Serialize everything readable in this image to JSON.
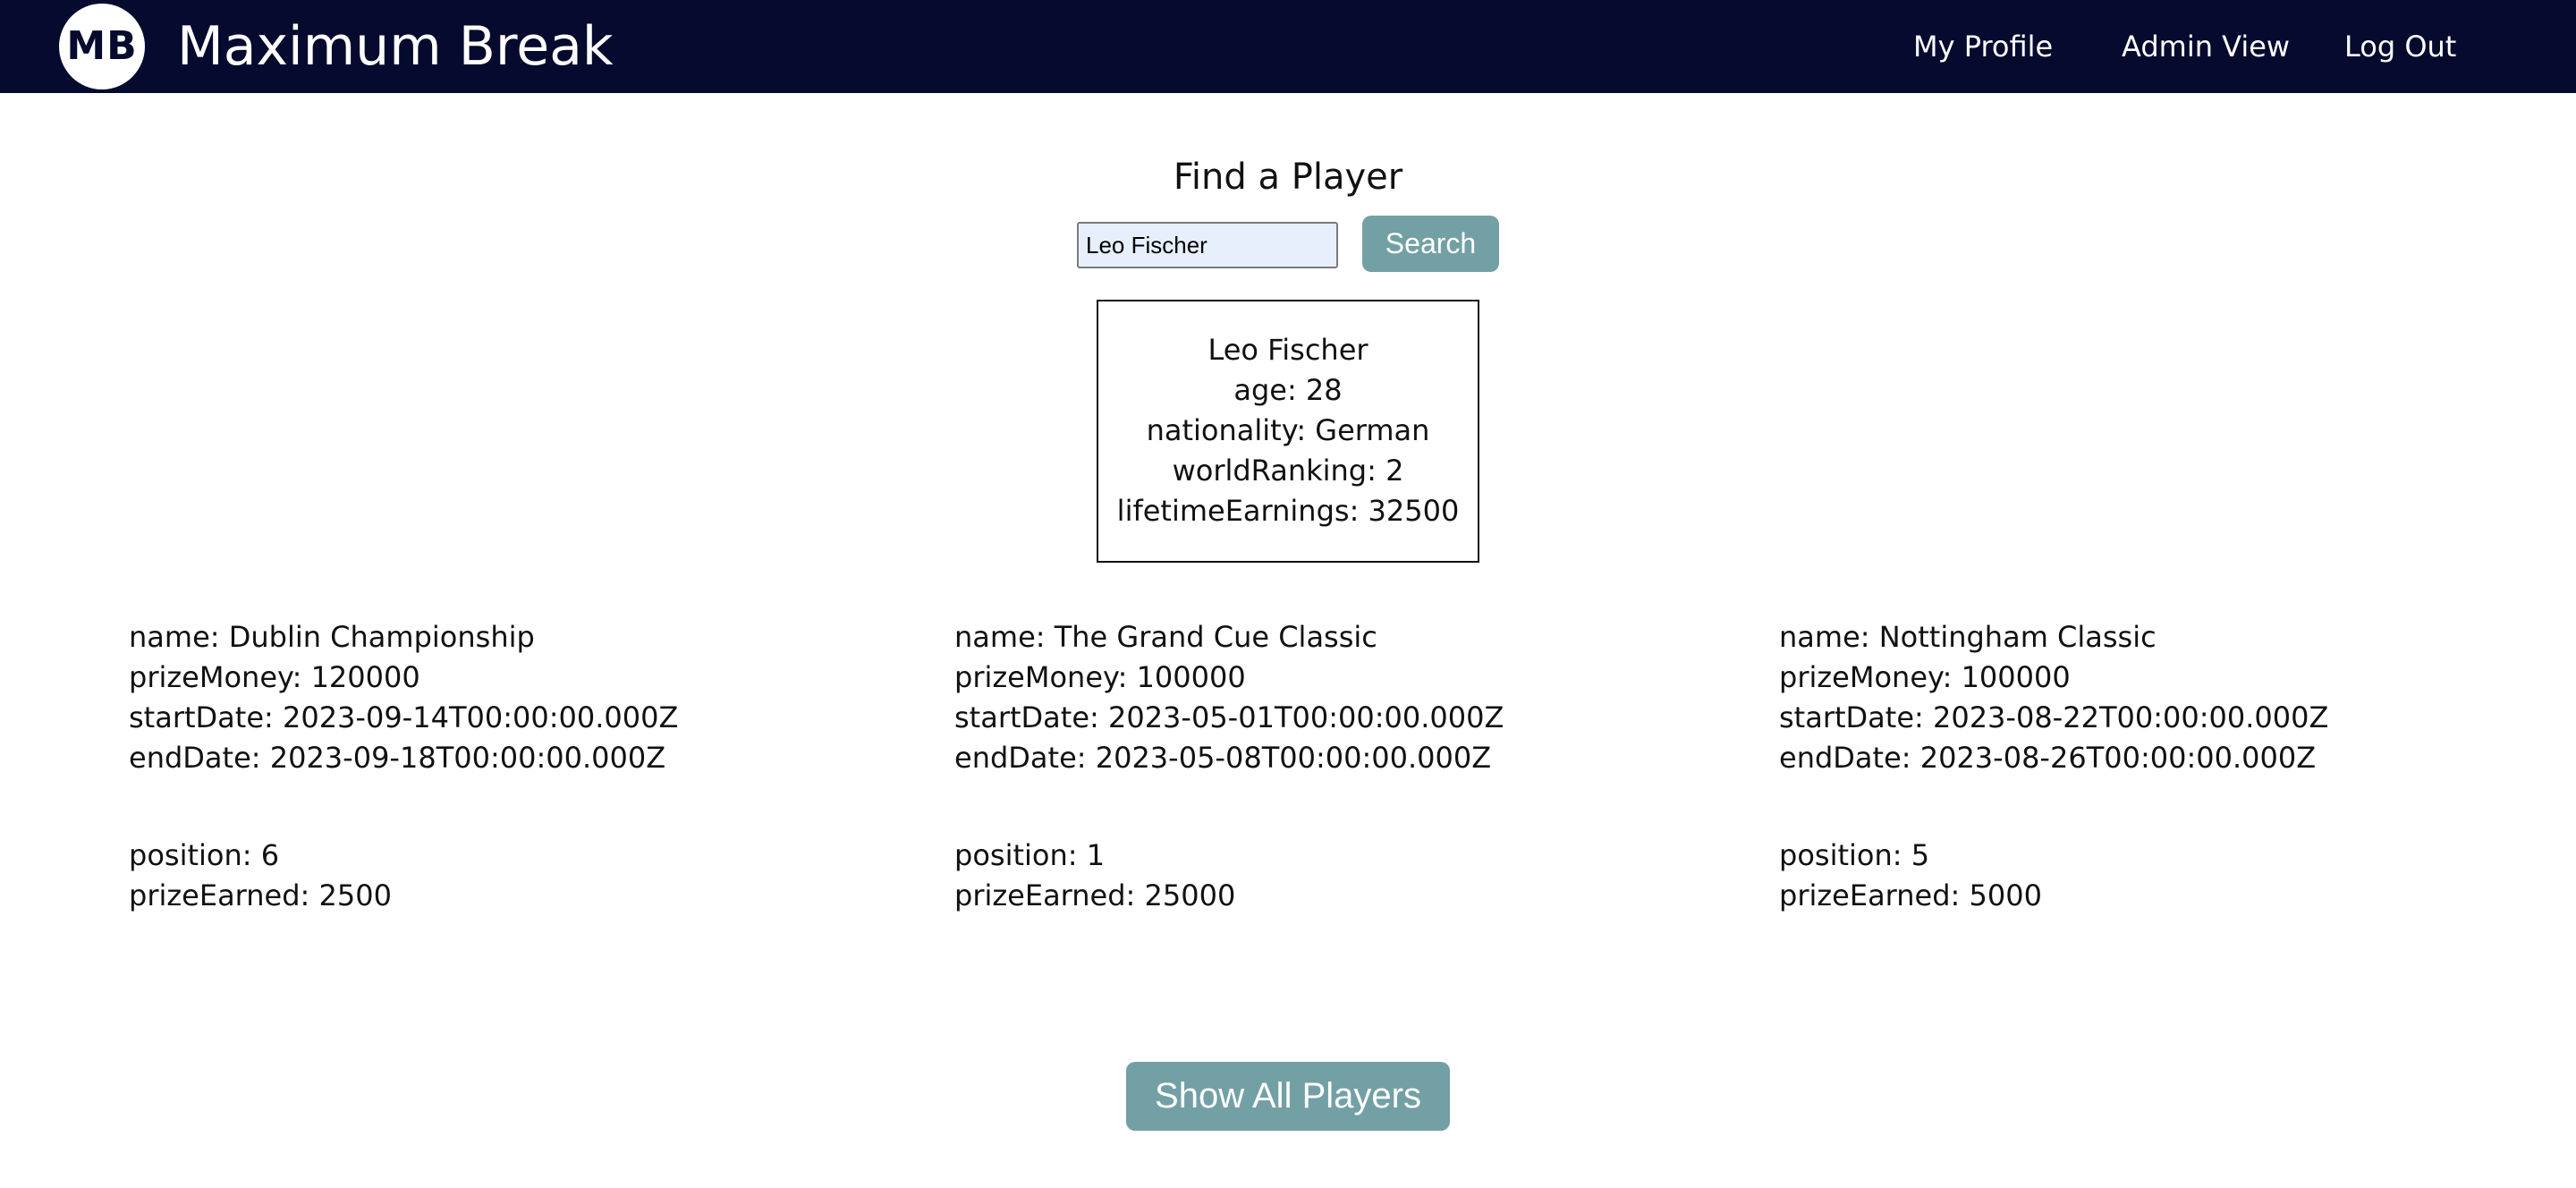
{
  "header": {
    "logo_text": "MB",
    "title": "Maximum Break",
    "nav": {
      "my_profile": "My Profile",
      "admin_view": "Admin View",
      "log_out": "Log Out"
    }
  },
  "search": {
    "heading": "Find a Player",
    "input_value": "Leo Fischer",
    "button_label": "Search"
  },
  "player": {
    "name": "Leo Fischer",
    "age": "age: 28",
    "nationality": "nationality: German",
    "world_ranking": "worldRanking: 2",
    "lifetime_earnings": "lifetimeEarnings: 32500"
  },
  "tournaments": [
    {
      "name": "name: Dublin Championship",
      "prize_money": "prizeMoney: 120000",
      "start_date": "startDate: 2023-09-14T00:00:00.000Z",
      "end_date": "endDate: 2023-09-18T00:00:00.000Z",
      "position": "position: 6",
      "prize_earned": "prizeEarned: 2500"
    },
    {
      "name": "name: The Grand Cue Classic",
      "prize_money": "prizeMoney: 100000",
      "start_date": "startDate: 2023-05-01T00:00:00.000Z",
      "end_date": "endDate: 2023-05-08T00:00:00.000Z",
      "position": "position: 1",
      "prize_earned": "prizeEarned: 25000"
    },
    {
      "name": "name: Nottingham Classic",
      "prize_money": "prizeMoney: 100000",
      "start_date": "startDate: 2023-08-22T00:00:00.000Z",
      "end_date": "endDate: 2023-08-26T00:00:00.000Z",
      "position": "position: 5",
      "prize_earned": "prizeEarned: 5000"
    }
  ],
  "footer": {
    "show_all_label": "Show All Players"
  },
  "colors": {
    "navbar": "#050a2e",
    "button": "#73a0a4",
    "input_bg": "#e8effc"
  }
}
